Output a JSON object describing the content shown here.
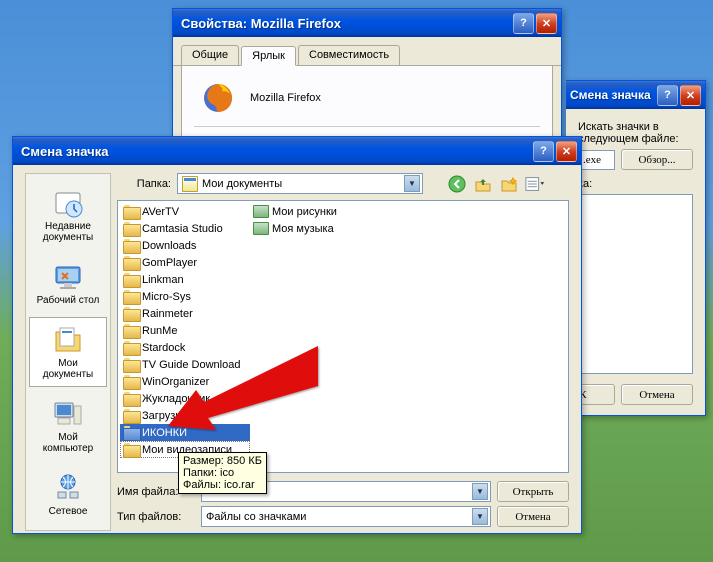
{
  "props_window": {
    "title": "Свойства: Mozilla Firefox",
    "tabs": [
      "Общие",
      "Ярлык",
      "Совместимость"
    ],
    "active_tab": 1,
    "app_name": "Mozilla Firefox"
  },
  "bg_change_icon": {
    "title": "Смена значка",
    "search_label": "Искать значки в следующем файле:",
    "path_value": ".exe",
    "browse_btn": "Обзор...",
    "list_label": "ка:",
    "ok_btn": "ОК",
    "cancel_btn": "Отмена"
  },
  "open_dialog": {
    "title": "Смена значка",
    "folder_label": "Папка:",
    "folder_value": "Мои документы",
    "places": [
      {
        "label": "Недавние документы",
        "icon": "recent"
      },
      {
        "label": "Рабочий стол",
        "icon": "desktop"
      },
      {
        "label": "Мои документы",
        "icon": "mydocs",
        "selected": true
      },
      {
        "label": "Мой компьютер",
        "icon": "computer"
      },
      {
        "label": "Сетевое",
        "icon": "network"
      }
    ],
    "files_col1": [
      "AVerTV",
      "Camtasia Studio",
      "Downloads",
      "GomPlayer",
      "Linkman",
      "Micro-Sys",
      "Rainmeter",
      "RunMe",
      "Stardock",
      "TV Guide Download",
      "WinOrganizer",
      "Жукладочник",
      "Загрузки"
    ],
    "selected_file": "ИКОНКИ",
    "after_selected": "Мои видеозаписи",
    "files_col2": [
      {
        "label": "Мои рисунки",
        "special": true
      },
      {
        "label": "Моя музыка",
        "special": true
      }
    ],
    "filename_label": "Имя файла:",
    "filename_value": "",
    "filetype_label": "Тип файлов:",
    "filetype_value": "Файлы со значками",
    "open_btn": "Открыть",
    "cancel_btn": "Отмена",
    "tooltip": "Размер: 850 КБ\nПапки: ico\nФайлы: ico.rar"
  }
}
